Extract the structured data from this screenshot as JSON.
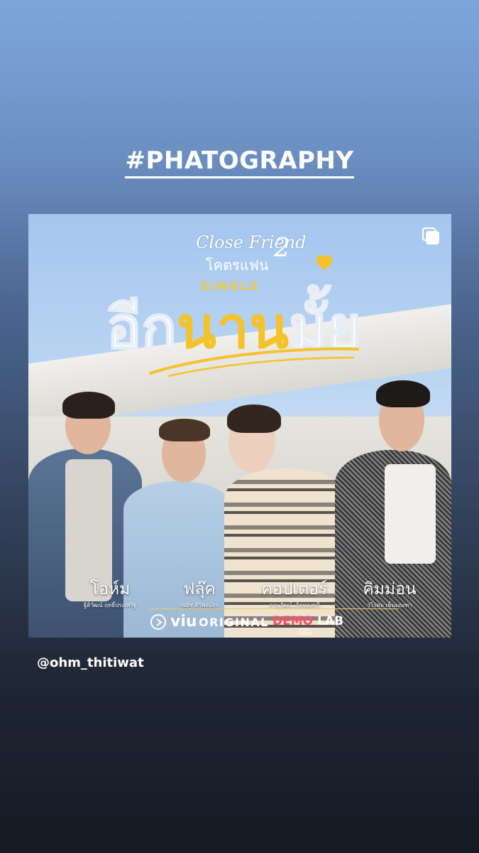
{
  "story": {
    "hashtag": "#PHATOGRAPHY",
    "username": "@ohm_thitiwat"
  },
  "post": {
    "logo_line1": "Close Friend",
    "logo_number": "2",
    "logo_thai": "โคตรแฟน",
    "single_label": "SINGLE",
    "title_part1": "อีก",
    "title_part2": "นาน",
    "title_part3": "มั้ย",
    "multi_image_icon": "multi-image-icon",
    "cast": [
      {
        "name": "โอห์ม",
        "full_name": "ฐิติวัฒน์ ฤทธิ์ประเสริฐ"
      },
      {
        "name": "ฟลุ๊ค",
        "full_name": "ณธัช ศิริพงษ์ธร"
      },
      {
        "name": "คอปเตอร์",
        "full_name": "ภานุวัฒน์ เกิดทองทวี"
      },
      {
        "name": "คิมม่อน",
        "full_name": "วโรดม เข็มมณฑา"
      }
    ],
    "brand_viu": "viu",
    "brand_original": "ORIGINAL",
    "brand_demo": "DEMO",
    "brand_lab": "LAB",
    "brand_demo_sub": "MUSIC HOUSE"
  },
  "colors": {
    "title_yellow": "#f4c22b",
    "demo_red": "#ff4d6d"
  }
}
